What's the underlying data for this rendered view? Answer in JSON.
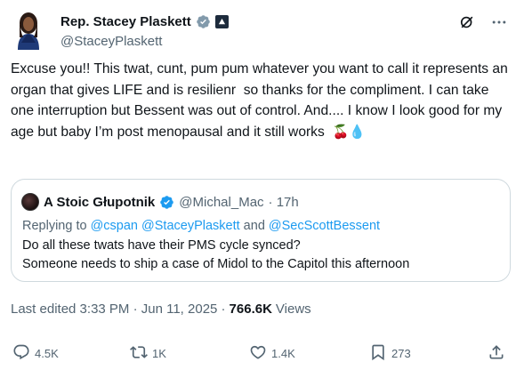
{
  "author": {
    "name": "Rep. Stacey Plaskett",
    "handle": "@StaceyPlaskett"
  },
  "tweet": {
    "text": "Excuse you!! This twat, cunt, pum pum whatever you want to call it represents an organ that gives LIFE and is resilienr  so thanks for the compliment. I can take one interruption but Bessent was out of control. And.... I know I look good for my age but baby I’m post menopausal and it still works  ",
    "emoji": "🍒💧"
  },
  "quote": {
    "name": "A Stoic Głupotnik",
    "handle": "@Michal_Mac",
    "time": "· 17h",
    "replying_prefix": "Replying to ",
    "replying_links": "@cspan @StaceyPlaskett",
    "replying_and": " and ",
    "replying_last": "@SecScottBessent",
    "line1": "Do all these twats have their PMS cycle synced?",
    "line2": "Someone needs to ship a case of Midol to the Capitol this afternoon"
  },
  "meta": {
    "edited": "Last edited 3:33 PM · Jun 11, 2025 ·",
    "views_count": "766.6K",
    "views_label": "Views"
  },
  "actions": {
    "replies": "4.5K",
    "reposts": "1K",
    "likes": "1.4K",
    "bookmarks": "273"
  },
  "colors": {
    "accent": "#1d9bf0",
    "muted": "#536471",
    "text": "#0f1419",
    "border": "#cfd9de"
  },
  "icons": [
    "verified-icon",
    "government-badge-icon",
    "grok-icon",
    "more-icon",
    "reply-icon",
    "repost-icon",
    "like-icon",
    "bookmark-icon",
    "share-icon"
  ]
}
